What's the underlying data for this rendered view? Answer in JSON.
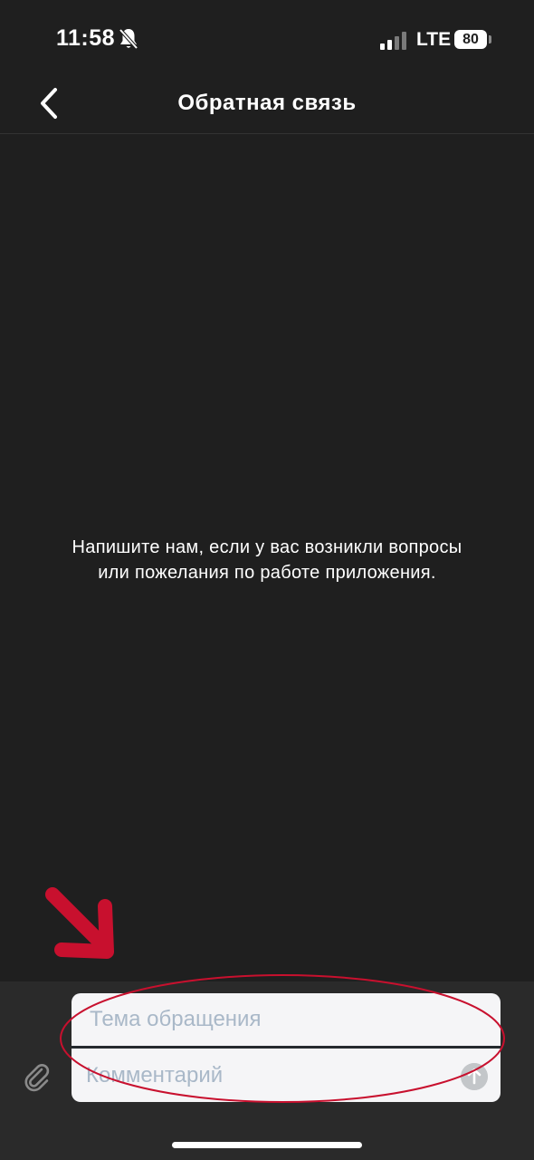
{
  "status_bar": {
    "time": "11:58",
    "network": "LTE",
    "battery": "80",
    "icons": [
      "bell-slash-icon",
      "signal-icon",
      "battery-icon"
    ]
  },
  "nav": {
    "title": "Обратная связь",
    "back_icon": "chevron-left-icon"
  },
  "empty_state": {
    "line1": "Напишите нам, если у вас возникли вопросы",
    "line2": "или пожелания по работе приложения."
  },
  "composer": {
    "subject_placeholder": "Тема обращения",
    "comment_placeholder": "Комментарий",
    "subject_value": "",
    "comment_value": "",
    "attach_icon": "paperclip-icon",
    "send_icon": "arrow-up-icon"
  },
  "annotations": {
    "arrow_icon": "red-arrow-icon",
    "highlight": "red-ellipse",
    "color": "#c8102e"
  },
  "colors": {
    "background": "#1f1f1f",
    "composer_background": "#2a2a2a",
    "input_background": "#f5f5f7",
    "placeholder": "#a9b8c8",
    "text": "#ffffff"
  }
}
